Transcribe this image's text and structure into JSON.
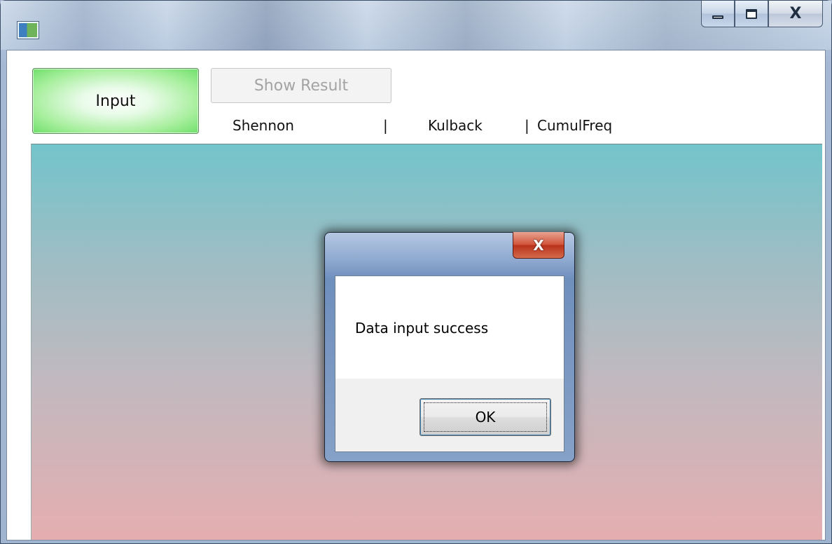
{
  "window": {
    "icon": "app-icon",
    "caption_buttons": [
      "minimize-icon",
      "maximize-icon",
      "close-icon"
    ],
    "close_glyph": "X"
  },
  "toolbar": {
    "input_label": "Input",
    "show_result_label": "Show Result"
  },
  "header_labels": {
    "shennon": "Shennon",
    "separator_1": "|",
    "kulback": "Kulback",
    "separator_2": "|",
    "cumulfreq": "CumulFreq"
  },
  "dialog": {
    "close_glyph": "X",
    "message": "Data input success",
    "ok_label": "OK"
  },
  "colors": {
    "input_button_green": "#6fdf6a",
    "canvas_top": "#73c4cb",
    "canvas_bottom": "#e5aeb0",
    "dialog_close_red": "#c83f26"
  }
}
